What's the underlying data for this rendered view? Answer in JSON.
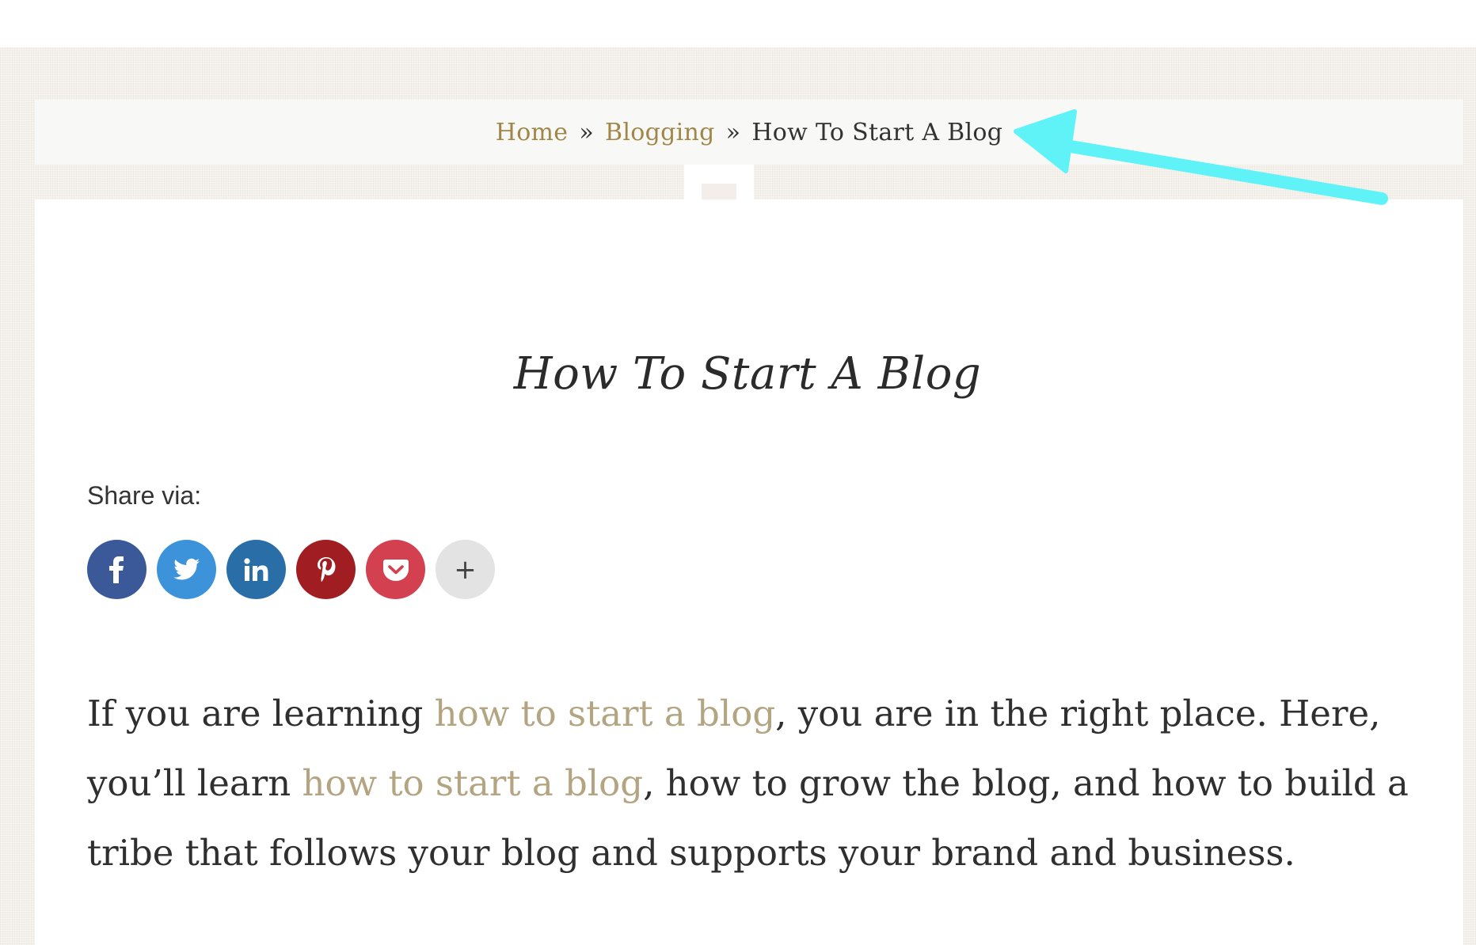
{
  "breadcrumb": {
    "home": "Home",
    "category": "Blogging",
    "separator": "»",
    "current": "How To Start A Blog"
  },
  "post": {
    "title": "How To Start A Blog"
  },
  "share": {
    "label": "Share via:",
    "buttons": [
      {
        "network": "facebook",
        "icon": "facebook-icon",
        "color": "#3b5998"
      },
      {
        "network": "twitter",
        "icon": "twitter-icon",
        "color": "#3d93d9"
      },
      {
        "network": "linkedin",
        "icon": "linkedin-icon",
        "color": "#2a6ea8"
      },
      {
        "network": "pinterest",
        "icon": "pinterest-icon",
        "color": "#a01e22"
      },
      {
        "network": "pocket",
        "icon": "pocket-icon",
        "color": "#d3404f"
      },
      {
        "network": "more",
        "icon": "plus-icon",
        "color": "#e3e3e3",
        "label": "+"
      }
    ]
  },
  "intro": {
    "part1": "If you are learning ",
    "link1": "how to start a blog",
    "part2": ", you are in the right place. Here, you’ll learn ",
    "link2": "how to start a blog",
    "part3": ", how to grow the blog, and how to build a tribe that follows your blog and supports your brand and business."
  },
  "colors": {
    "link_gold": "#a08747",
    "link_muted": "#b4a582",
    "annotation_arrow": "#5ff3f7"
  }
}
